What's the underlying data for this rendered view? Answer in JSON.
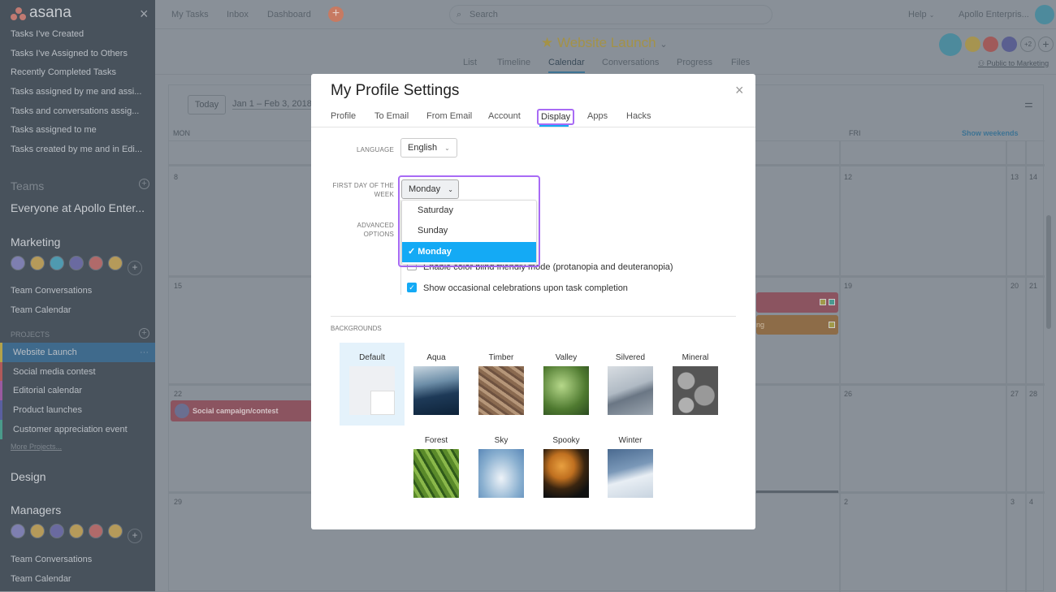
{
  "sidebar": {
    "logo": "asana",
    "close": "×",
    "reports": [
      "Tasks I've Created",
      "Tasks I've Assigned to Others",
      "Recently Completed Tasks",
      "Tasks assigned by me and assi...",
      "Tasks and conversations assig...",
      "Tasks assigned to me",
      "Tasks created by me and in Edi..."
    ],
    "teams_label": "Teams",
    "team1": "Everyone at Apollo Enter...",
    "marketing": "Marketing",
    "marketing_links": [
      "Team Conversations",
      "Team Calendar"
    ],
    "projects_label": "PROJECTS",
    "projects": [
      {
        "label": "Website Launch",
        "color": "#b3a24a"
      },
      {
        "label": "Social media contest",
        "color": "#b05a5a"
      },
      {
        "label": "Editorial calendar",
        "color": "#9a5aa0"
      },
      {
        "label": "Product launches",
        "color": "#5a5fa0"
      },
      {
        "label": "Customer appreciation event",
        "color": "#4a9a8a"
      }
    ],
    "more_projects": "More Projects...",
    "design": "Design",
    "managers": "Managers",
    "managers_links": [
      "Team Conversations",
      "Team Calendar"
    ]
  },
  "topbar": {
    "nav": [
      "My Tasks",
      "Inbox",
      "Dashboard"
    ],
    "search_placeholder": "Search",
    "help": "Help",
    "org": "Apollo Enterpris..."
  },
  "project": {
    "title": "Website Launch",
    "tabs": [
      "List",
      "Timeline",
      "Calendar",
      "Conversations",
      "Progress",
      "Files"
    ],
    "active_tab": "Calendar",
    "members_extra": "+2",
    "visibility": "Public to Marketing"
  },
  "calendar": {
    "today": "Today",
    "range": "Jan 1 – Feb 3, 2018",
    "mon": "MON",
    "fri": "FRI",
    "show_weekends": "Show weekends",
    "dates": {
      "r1": [
        "8",
        "12",
        "13",
        "14"
      ],
      "r2": [
        "15",
        "19",
        "20",
        "21"
      ],
      "r3": [
        "22",
        "26",
        "27",
        "28"
      ],
      "r4": [
        "29",
        "2",
        "3",
        "4"
      ]
    },
    "events": {
      "social": "Social campaign/contest",
      "partial": "ng"
    }
  },
  "modal": {
    "title": "My Profile Settings",
    "close": "×",
    "tabs": [
      "Profile",
      "To Email",
      "From Email",
      "Account",
      "Display",
      "Apps",
      "Hacks"
    ],
    "active_tab": "Display",
    "language_label": "LANGUAGE",
    "language_value": "English",
    "first_day_label": "FIRST DAY OF THE WEEK",
    "first_day_value": "Monday",
    "first_day_options": [
      "Saturday",
      "Sunday",
      "Monday"
    ],
    "first_day_selected": "Monday",
    "advanced_label": "ADVANCED OPTIONS",
    "colorblind": {
      "label": "Enable color blind friendly mode (protanopia and deuteranopia)",
      "checked": false
    },
    "celebrations": {
      "label": "Show occasional celebrations upon task completion",
      "checked": true
    },
    "backgrounds_label": "BACKGROUNDS",
    "backgrounds": [
      "Default",
      "Aqua",
      "Timber",
      "Valley",
      "Silvered",
      "Mineral",
      "Forest",
      "Sky",
      "Spooky",
      "Winter"
    ],
    "selected_background": "Default"
  },
  "colors": {
    "accent": "#14aaf5",
    "highlight": "#a86bf5"
  }
}
